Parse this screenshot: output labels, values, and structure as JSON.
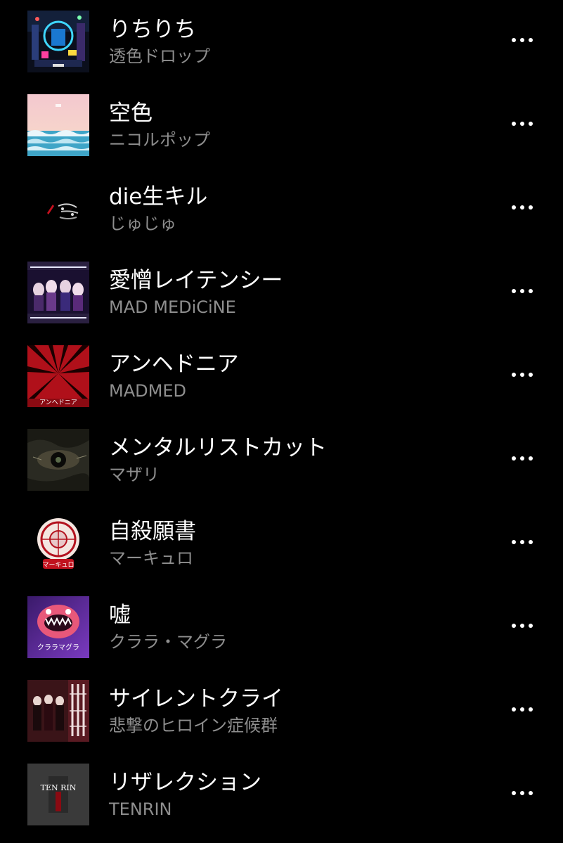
{
  "tracks": [
    {
      "title": "りちりち",
      "artist": "透色ドロップ",
      "art": "night-city"
    },
    {
      "title": "空色",
      "artist": "ニコルポップ",
      "art": "sea-sky"
    },
    {
      "title": "die生キル",
      "artist": "じゅじゅ",
      "art": "dark-knife"
    },
    {
      "title": "愛憎レイテンシー",
      "artist": "MAD MEDiCiNE",
      "art": "group-purple"
    },
    {
      "title": "アンヘドニア",
      "artist": "MADMED",
      "art": "red-burst",
      "art_text": "アンヘドニア"
    },
    {
      "title": "メンタルリストカット",
      "artist": "マザリ",
      "art": "eye"
    },
    {
      "title": "自殺願書",
      "artist": "マーキュロ",
      "art": "crest",
      "art_text": "マーキュロ"
    },
    {
      "title": "嘘",
      "artist": "クララ・マグラ",
      "art": "monster-mouth",
      "art_text": "クララマグラ"
    },
    {
      "title": "サイレントクライ",
      "artist": "悲撃のヒロイン症候群",
      "art": "group-text"
    },
    {
      "title": "リザレクション",
      "artist": "TENRIN",
      "art": "logo-grey",
      "art_text": "TEN RIN"
    }
  ],
  "colors": {
    "background": "#000000",
    "title": "#ffffff",
    "artist": "#8e8e8e",
    "more_dots": "#ffffff"
  },
  "icons": {
    "more": "more-horizontal-icon"
  }
}
